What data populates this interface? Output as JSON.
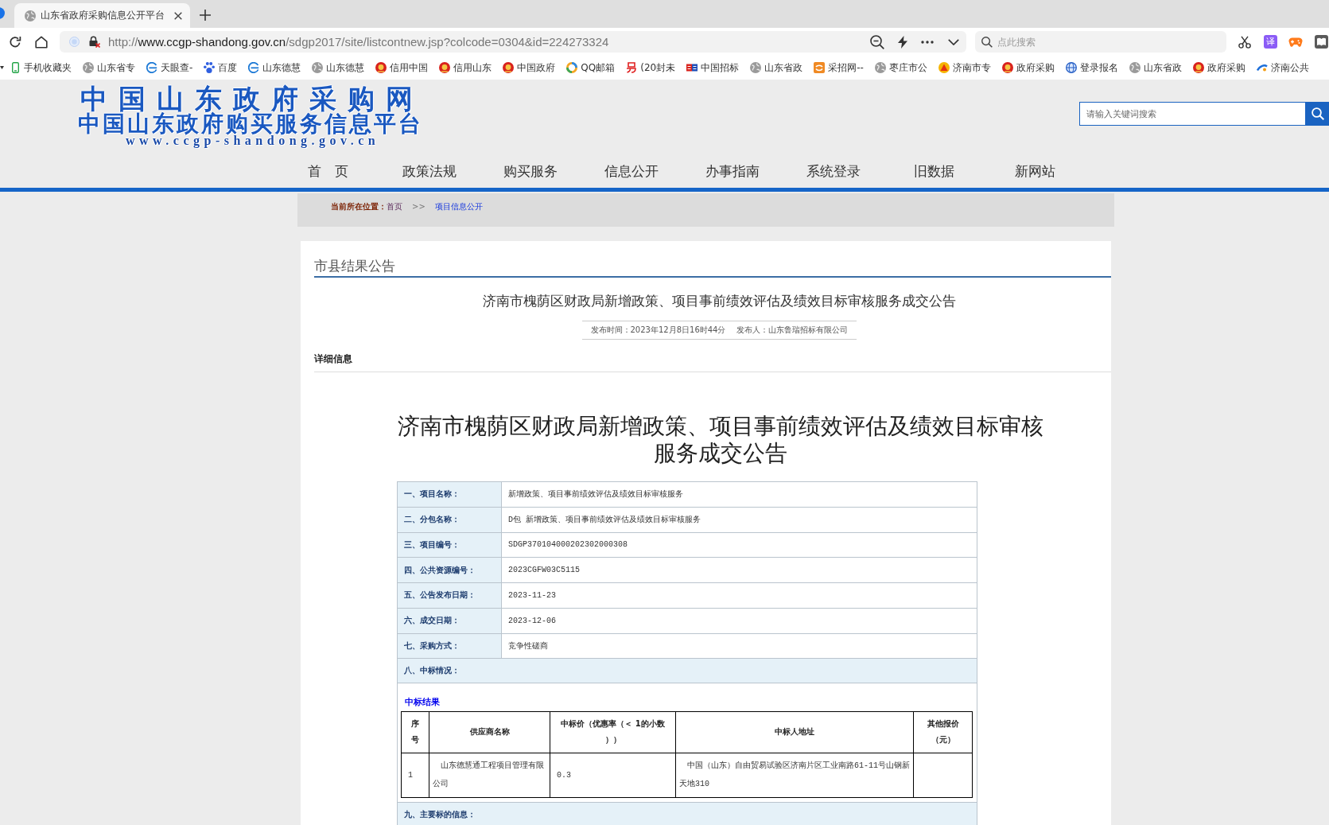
{
  "browser": {
    "tabs": [
      {
        "title": "山东省政府采购信息公开平台",
        "selected": true
      }
    ],
    "address": {
      "scheme": "http://",
      "host": "www.ccgp-shandong.gov.cn",
      "path": "/sdgp2017/site/listcontnew.jsp?colcode=0304&id=224273324"
    },
    "search": {
      "placeholder": "点此搜索"
    },
    "translate_label": "译",
    "bookmarks": [
      {
        "kind": "phone",
        "label": "手机收藏夹"
      },
      {
        "kind": "globe",
        "label": "山东省专"
      },
      {
        "kind": "swirl",
        "label": "天眼查-"
      },
      {
        "kind": "paw",
        "label": "百度"
      },
      {
        "kind": "swirl",
        "label": "山东德慧"
      },
      {
        "kind": "globe",
        "label": "山东德慧"
      },
      {
        "kind": "emblem",
        "label": "信用中国"
      },
      {
        "kind": "emblem",
        "label": "信用山东"
      },
      {
        "kind": "emblem",
        "label": "中国政府"
      },
      {
        "kind": "ring",
        "label": "QQ邮箱"
      },
      {
        "kind": "squiggle",
        "label": "(20封未"
      },
      {
        "kind": "stripes",
        "label": "中国招标"
      },
      {
        "kind": "globe",
        "label": "山东省政"
      },
      {
        "kind": "tile",
        "label": "采招网--"
      },
      {
        "kind": "globe",
        "label": "枣庄市公"
      },
      {
        "kind": "triangle",
        "label": "济南市专"
      },
      {
        "kind": "emblem",
        "label": "政府采购"
      },
      {
        "kind": "earth",
        "label": "登录报名"
      },
      {
        "kind": "globe",
        "label": "山东省政"
      },
      {
        "kind": "emblem",
        "label": "政府采购"
      },
      {
        "kind": "swoosh",
        "label": "济南公共"
      }
    ]
  },
  "site": {
    "logo": {
      "title": "中国山东政府采购网",
      "subtitle": "中国山东政府购买服务信息平台",
      "domain": "www.ccgp-shandong.gov.cn"
    },
    "search": {
      "placeholder": "请输入关键词搜索"
    },
    "nav": [
      "首　页",
      "政策法规",
      "购买服务",
      "信息公开",
      "办事指南",
      "系统登录",
      "旧数据",
      "新网站"
    ],
    "breadcrumb": {
      "label": "当前所在位置：",
      "separator": ">>",
      "items": [
        {
          "label": "首页",
          "current": false
        },
        {
          "label": "项目信息公开",
          "current": true
        }
      ]
    }
  },
  "article": {
    "section": "市县结果公告",
    "title": "济南市槐荫区财政局新增政策、项目事前绩效评估及绩效目标审核服务成交公告",
    "published": "发布时间：2023年12月8日16时44分",
    "publisher": "发布人：山东鲁瑞招标有限公司",
    "details_heading": "详细信息",
    "heading": "济南市槐荫区财政局新增政策、项目事前绩效评估及绩效目标审核服务成交公告",
    "rows": [
      {
        "kind": "field",
        "label": "一、项目名称：",
        "value": "新增政策、项目事前绩效评估及绩效目标审核服务"
      },
      {
        "kind": "field",
        "label": "二、分包名称：",
        "value": "D包 新增政策、项目事前绩效评估及绩效目标审核服务"
      },
      {
        "kind": "field",
        "label": "三、项目编号：",
        "value": "SDGP370104000202302000308"
      },
      {
        "kind": "field",
        "label": "四、公共资源编号：",
        "value": "2023CGFW03C5115"
      },
      {
        "kind": "field",
        "label": "五、公告发布日期：",
        "value": "2023-11-23"
      },
      {
        "kind": "field",
        "label": "六、成交日期：",
        "value": "2023-12-06"
      },
      {
        "kind": "field",
        "label": "七、采购方式：",
        "value": "竞争性磋商"
      },
      {
        "kind": "section",
        "label": "八、中标情况："
      },
      {
        "kind": "results",
        "title": "中标结果",
        "columns": [
          "序号",
          "供应商名称",
          "中标价（优惠率（＜ 1的小数））",
          "中标人地址",
          "其他报价（元）"
        ],
        "rows": [
          {
            "cells": [
              "1",
              "山东德慧通工程项目管理有限公司",
              "0.3",
              "中国（山东）自由贸易试验区济南片区工业南路61-11号山钢新天地310"
            ]
          }
        ]
      },
      {
        "kind": "section",
        "label": "九、主要标的信息："
      }
    ]
  }
}
